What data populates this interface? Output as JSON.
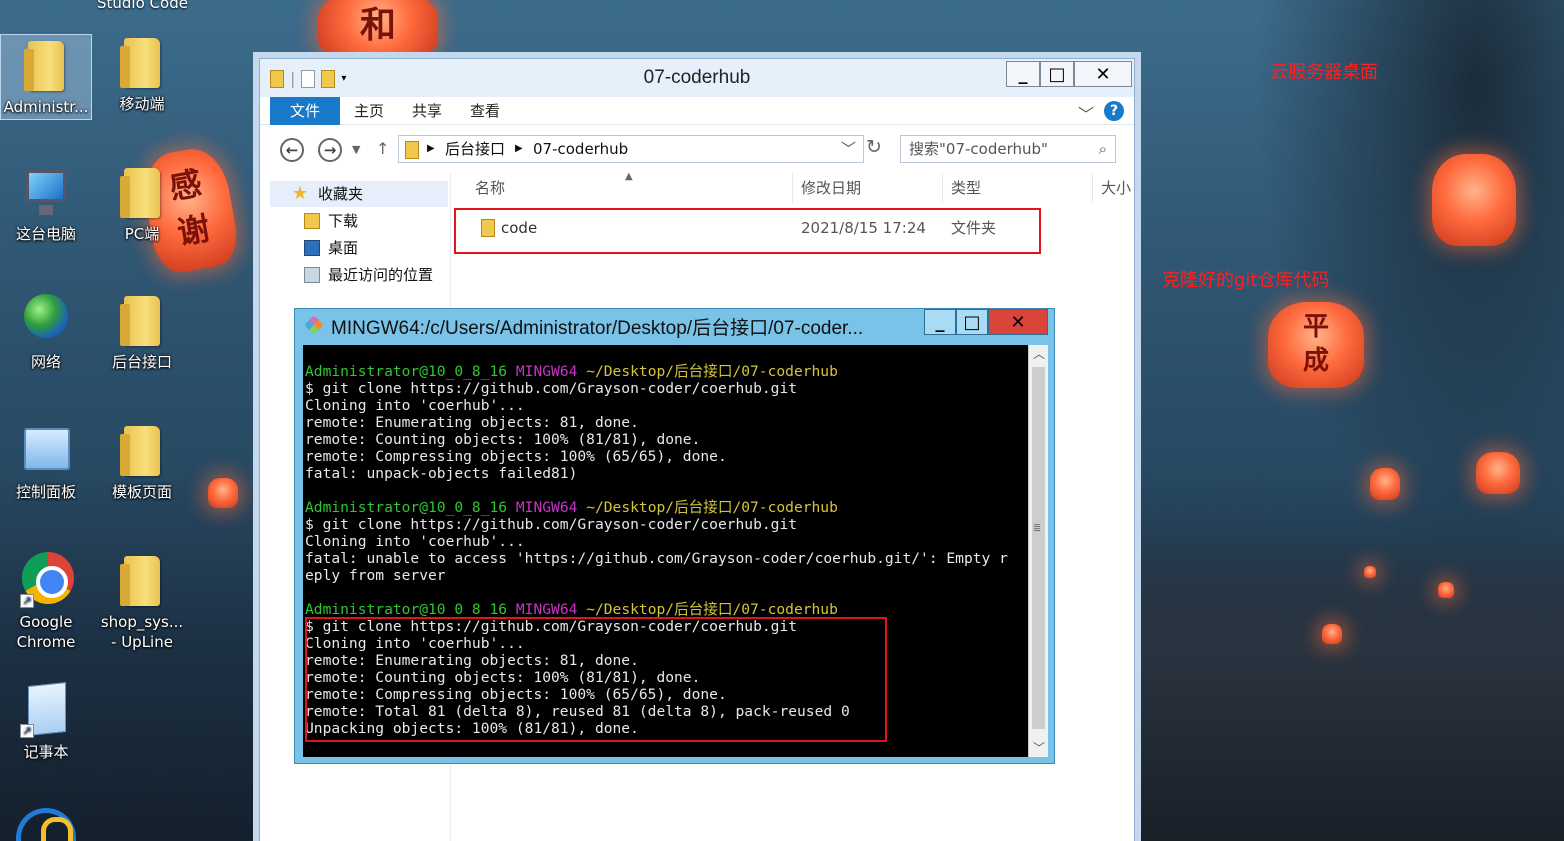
{
  "desktop": {
    "partial_top_label": "Studio Code",
    "icons": [
      {
        "label": "Administr...",
        "icon": "user-folder-icon"
      },
      {
        "label": "移动端",
        "icon": "folder-icon"
      },
      {
        "label": "这台电脑",
        "icon": "computer-icon"
      },
      {
        "label": "PC端",
        "icon": "folder-icon"
      },
      {
        "label": "网络",
        "icon": "network-icon"
      },
      {
        "label": "后台接口",
        "icon": "folder-icon"
      },
      {
        "label": "控制面板",
        "icon": "control-panel-icon"
      },
      {
        "label": "模板页面",
        "icon": "folder-icon"
      },
      {
        "label": "Google Chrome",
        "line1": "Google",
        "line2": "Chrome",
        "icon": "chrome-icon"
      },
      {
        "label": "shop_sys... - UpLine",
        "line1": "shop_sys...",
        "line2": "- UpLine",
        "icon": "folder-icon"
      },
      {
        "label": "记事本",
        "icon": "notepad-icon"
      }
    ],
    "lanterns": [
      "和",
      "感",
      "谢",
      "平",
      "成"
    ]
  },
  "annotations": {
    "cloud_desktop": "云服务器桌面",
    "cloned_repo": "克隆好的git仓库代码",
    "arrow_color": "#e0141a"
  },
  "explorer": {
    "title": "07-coderhub",
    "ribbon_tabs": [
      "文件",
      "主页",
      "共享",
      "查看"
    ],
    "address": [
      "后台接口",
      "07-coderhub"
    ],
    "search_placeholder": "搜索\"07-coderhub\"",
    "nav": [
      "收藏夹",
      "下载",
      "桌面",
      "最近访问的位置"
    ],
    "columns": [
      "名称",
      "修改日期",
      "类型",
      "大小"
    ],
    "files": [
      {
        "name": "code",
        "modified": "2021/8/15 17:24",
        "type": "文件夹"
      }
    ]
  },
  "terminal": {
    "title": "MINGW64:/c/Users/Administrator/Desktop/后台接口/07-coder...",
    "prompt": {
      "user": "Administrator@10_0_8_16",
      "env": "MINGW64",
      "path": "~/Desktop/后台接口/07-coderhub"
    },
    "blocks": [
      [
        "$ git clone https://github.com/Grayson-coder/coerhub.git",
        "Cloning into 'coerhub'...",
        "remote: Enumerating objects: 81, done.",
        "remote: Counting objects: 100% (81/81), done.",
        "remote: Compressing objects: 100% (65/65), done.",
        "fatal: unpack-objects failed81)"
      ],
      [
        "$ git clone https://github.com/Grayson-coder/coerhub.git",
        "Cloning into 'coerhub'...",
        "fatal: unable to access 'https://github.com/Grayson-coder/coerhub.git/': Empty r",
        "eply from server"
      ],
      [
        "$ git clone https://github.com/Grayson-coder/coerhub.git",
        "Cloning into 'coerhub'...",
        "remote: Enumerating objects: 81, done.",
        "remote: Counting objects: 100% (81/81), done.",
        "remote: Compressing objects: 100% (65/65), done.",
        "remote: Total 81 (delta 8), reused 81 (delta 8), pack-reused 0",
        "Unpacking objects: 100% (81/81), done."
      ]
    ]
  }
}
